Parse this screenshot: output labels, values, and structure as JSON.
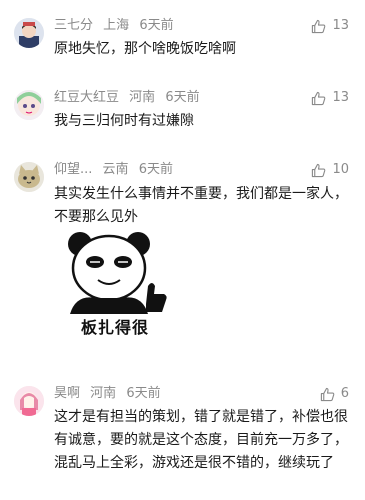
{
  "comments": [
    {
      "user": "三七分",
      "location": "上海",
      "time": "6天前",
      "likes": "13",
      "text": "原地失忆，那个啥晚饭吃啥啊",
      "avatar_icon": "avatar-boy-icon"
    },
    {
      "user": "红豆大红豆",
      "location": "河南",
      "time": "6天前",
      "likes": "13",
      "text": "我与三归何时有过嫌隙",
      "avatar_icon": "avatar-anime-girl-icon"
    },
    {
      "user": "仰望...",
      "location": "云南",
      "time": "6天前",
      "likes": "10",
      "text": "其实发生什么事情并不重要，我们都是一家人，不要那么见外",
      "sticker_caption": "板扎得很",
      "avatar_icon": "avatar-cat-icon"
    },
    {
      "user": "昊啊",
      "location": "河南",
      "time": "6天前",
      "likes": "6",
      "text": "这才是有担当的策划，错了就是错了，补偿也很有诚意，要的就是这个态度，目前充一万多了，混乱马上全彩，游戏还是很不错的，继续玩了",
      "avatar_icon": "avatar-pink-girl-icon"
    }
  ],
  "colors": {
    "meta_text": "#8a8a8a",
    "body_text": "#1a1a1a"
  }
}
